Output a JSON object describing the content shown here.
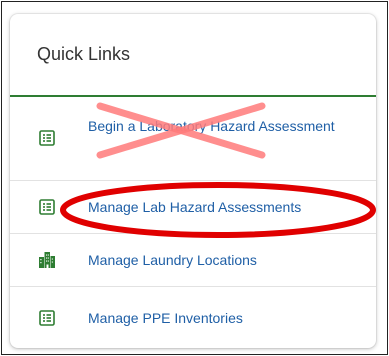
{
  "card": {
    "title": "Quick Links"
  },
  "links": [
    {
      "label": "Begin a Laboratory Hazard Assessment",
      "icon": "list-icon",
      "status": "crossed-out"
    },
    {
      "label": "Manage Lab Hazard Assessments",
      "icon": "list-icon",
      "status": "circled"
    },
    {
      "label": "Manage Laundry Locations",
      "icon": "building-icon"
    },
    {
      "label": "Manage PPE Inventories",
      "icon": "list-icon"
    }
  ],
  "colors": {
    "accent_green": "#2e7d32",
    "link_blue": "#1f5fa6",
    "annotation_red": "#e00000",
    "cross_red": "#ff7b7b"
  }
}
